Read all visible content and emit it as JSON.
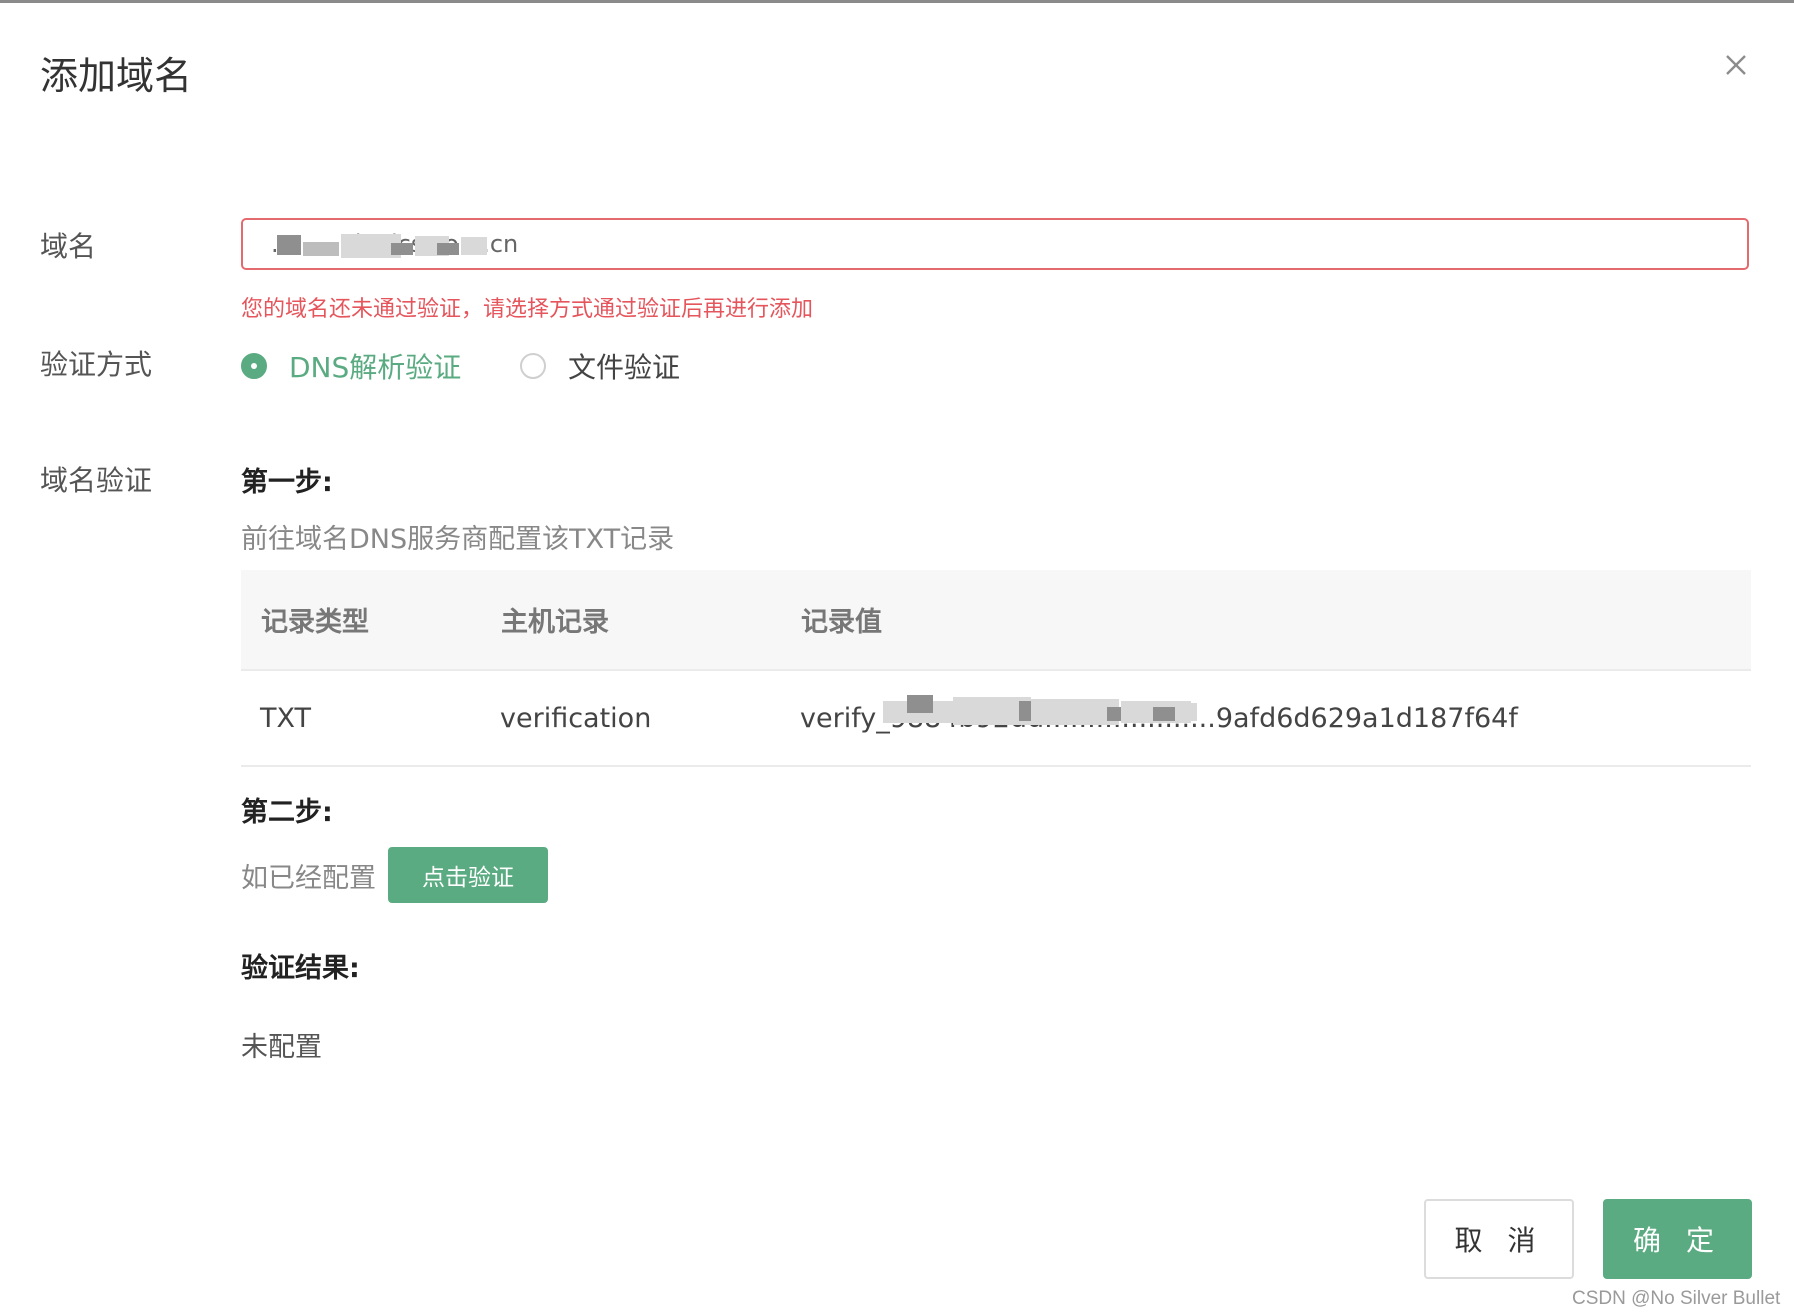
{
  "dialog": {
    "title": "添加域名",
    "close_icon": "close-icon"
  },
  "domain": {
    "label": "域名",
    "value": "...........h.cics.com.cn",
    "error": "您的域名还未通过验证，请选择方式通过验证后再进行添加"
  },
  "verify_method": {
    "label": "验证方式",
    "options": [
      {
        "label": "DNS解析验证",
        "selected": true
      },
      {
        "label": "文件验证",
        "selected": false
      }
    ]
  },
  "domain_verify": {
    "label": "域名验证",
    "step1_title": "第一步:",
    "step1_desc": "前往域名DNS服务商配置该TXT记录",
    "table": {
      "headers": [
        "记录类型",
        "主机记录",
        "记录值"
      ],
      "rows": [
        [
          "TXT",
          "verification",
          "verify_9884b92dd....................9afd6d629a1d187f64f"
        ]
      ]
    },
    "step2_title": "第二步:",
    "step2_desc": "如已经配置",
    "verify_button": "点击验证",
    "result_title": "验证结果:",
    "result_value": "未配置"
  },
  "footer": {
    "cancel": "取 消",
    "confirm": "确 定"
  },
  "watermark": "CSDN @No Silver Bullet",
  "colors": {
    "accent": "#5aab81",
    "error": "#e5555c"
  }
}
